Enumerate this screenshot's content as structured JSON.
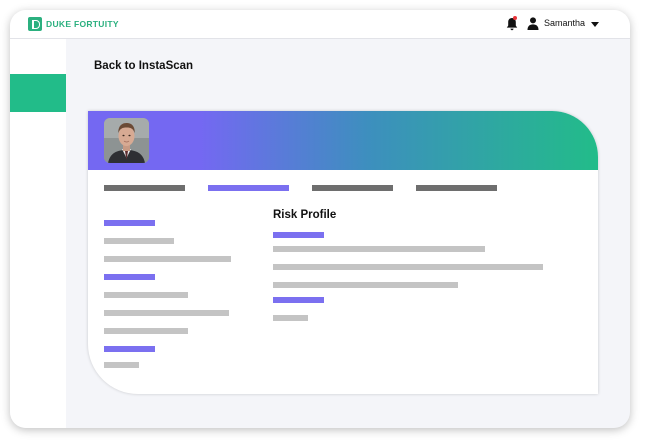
{
  "app": {
    "brand_name": "DUKE FORTUITY",
    "brand_color": "#2bb07f",
    "accent_color": "#7b70f0"
  },
  "header": {
    "notification_icon": "bell-icon",
    "user_icon": "user-icon",
    "user_name": "Samantha",
    "menu_icon": "caret-down-icon"
  },
  "sidebar": {
    "items": [
      {
        "state": "active",
        "color": "#22bc89"
      }
    ]
  },
  "page": {
    "back_link": "Back to InstaScan"
  },
  "profile": {
    "avatar": "person-photo",
    "tabs": [
      {
        "state": "inactive"
      },
      {
        "state": "active"
      },
      {
        "state": "inactive"
      },
      {
        "state": "inactive"
      }
    ],
    "section_title": "Risk Profile"
  }
}
